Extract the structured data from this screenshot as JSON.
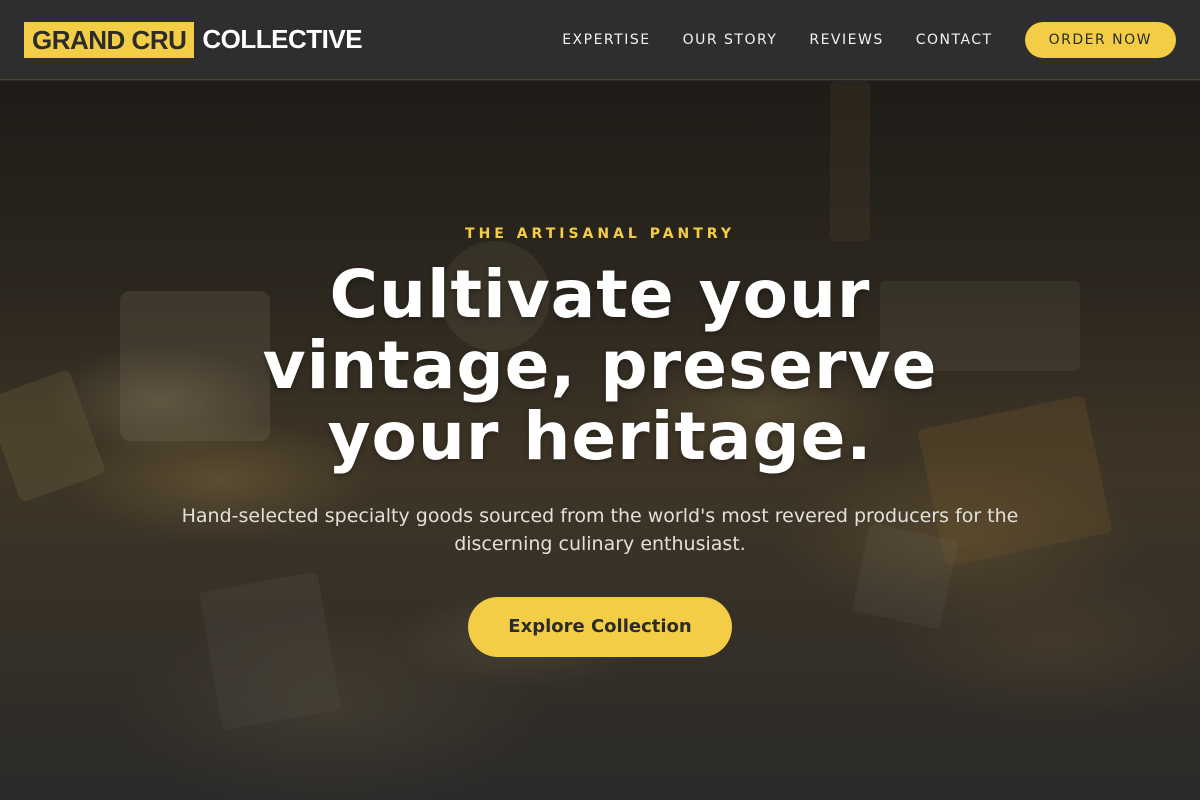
{
  "brand": {
    "logo_box_text": "GRAND CRU",
    "logo_rest_text": "COLLECTIVE"
  },
  "nav": {
    "items": [
      {
        "label": "EXPERTISE"
      },
      {
        "label": "OUR STORY"
      },
      {
        "label": "REVIEWS"
      },
      {
        "label": "CONTACT"
      }
    ],
    "cta_label": "ORDER NOW"
  },
  "hero": {
    "eyebrow": "THE ARTISANAL PANTRY",
    "headline": "Cultivate your vintage, preserve your heritage.",
    "subtext": "Hand-selected specialty goods sourced from the world's most revered producers for the discerning culinary enthusiast.",
    "cta_label": "Explore Collection"
  },
  "colors": {
    "accent": "#f2cd45",
    "header_bg": "#2e2e2e",
    "text_light": "#ffffff"
  }
}
